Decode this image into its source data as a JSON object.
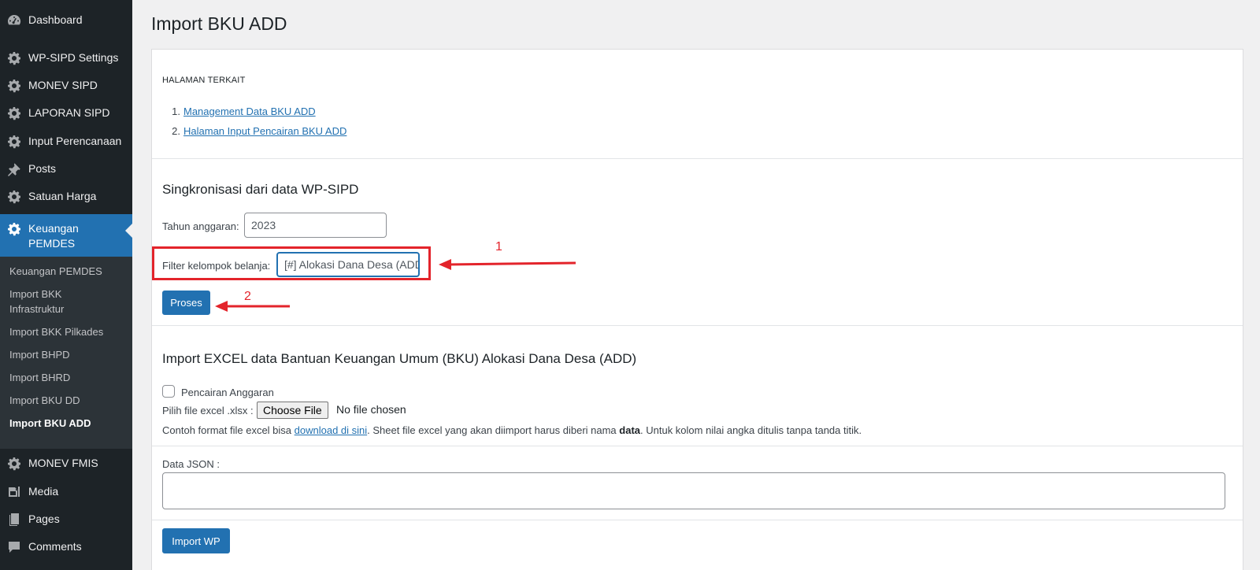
{
  "sidebar": {
    "menu": [
      {
        "label": "Dashboard",
        "icon": "dashboard-icon"
      },
      {
        "label": "WP-SIPD Settings",
        "icon": "gear-icon"
      },
      {
        "label": "MONEV SIPD",
        "icon": "gear-icon"
      },
      {
        "label": "LAPORAN SIPD",
        "icon": "gear-icon"
      },
      {
        "label": "Input Perencanaan",
        "icon": "gear-icon"
      },
      {
        "label": "Posts",
        "icon": "pin-icon"
      },
      {
        "label": "Satuan Harga",
        "icon": "gear-icon"
      },
      {
        "label": "Keuangan PEMDES",
        "icon": "gear-icon"
      }
    ],
    "submenu": [
      "Keuangan PEMDES",
      "Import BKK Infrastruktur",
      "Import BKK Pilkades",
      "Import BHPD",
      "Import BHRD",
      "Import BKU DD",
      "Import BKU ADD"
    ],
    "bottom_menu": [
      {
        "label": "MONEV FMIS",
        "icon": "gear-icon"
      },
      {
        "label": "Media",
        "icon": "media-icon"
      },
      {
        "label": "Pages",
        "icon": "pages-icon"
      },
      {
        "label": "Comments",
        "icon": "comment-icon"
      }
    ]
  },
  "page": {
    "title": "Import BKU ADD",
    "related_heading": "HALAMAN TERKAIT",
    "related_links": [
      {
        "num": "1.",
        "label": "Management Data BKU ADD"
      },
      {
        "num": "2.",
        "label": "Halaman Input Pencairan BKU ADD"
      }
    ],
    "sync": {
      "title": "Singkronisasi dari data WP-SIPD",
      "year_label": "Tahun anggaran:",
      "year_value": "2023",
      "filter_label": "Filter kelompok belanja:",
      "filter_value": "[#] Alokasi Dana Desa (ADD)",
      "process_button": "Proses"
    },
    "import": {
      "title": "Import EXCEL data Bantuan Keuangan Umum (BKU) Alokasi Dana Desa (ADD)",
      "checkbox_label": "Pencairan Anggaran",
      "file_label": "Pilih file excel .xlsx :",
      "file_button": "Choose File",
      "file_status": "No file chosen",
      "help_prefix": "Contoh format file excel bisa ",
      "help_link": "download di sini",
      "help_mid": ". Sheet file excel yang akan diimport harus diberi nama ",
      "help_bold": "data",
      "help_suffix": ". Untuk kolom nilai angka ditulis tanpa tanda titik.",
      "json_label": "Data JSON :",
      "json_value": "",
      "import_button": "Import WP"
    },
    "annotations": {
      "first": "1",
      "second": "2"
    }
  }
}
